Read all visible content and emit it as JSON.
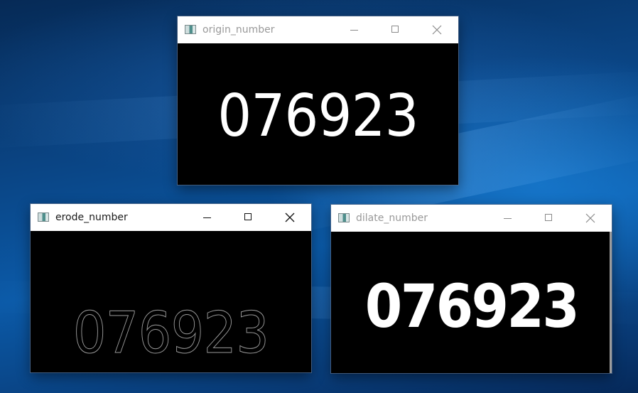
{
  "desktop": {
    "background_colors": [
      "#062a56",
      "#0b5aa8",
      "#1e8ce6"
    ]
  },
  "windows": [
    {
      "title": "origin_number",
      "state": "inactive",
      "displayed_text": "076923",
      "icon": "app-window-icon"
    },
    {
      "title": "erode_number",
      "state": "active",
      "displayed_text": "076923",
      "icon": "app-window-icon"
    },
    {
      "title": "dilate_number",
      "state": "inactive",
      "displayed_text": "076923",
      "icon": "app-window-icon"
    }
  ],
  "controls": {
    "minimize_icon": "minimize-icon",
    "maximize_icon": "maximize-icon",
    "close_icon": "close-icon"
  },
  "colors": {
    "titlebar_bg": "#ffffff",
    "content_bg": "#000000",
    "inactive_title": "#999999",
    "active_title": "#1a1a1a"
  }
}
